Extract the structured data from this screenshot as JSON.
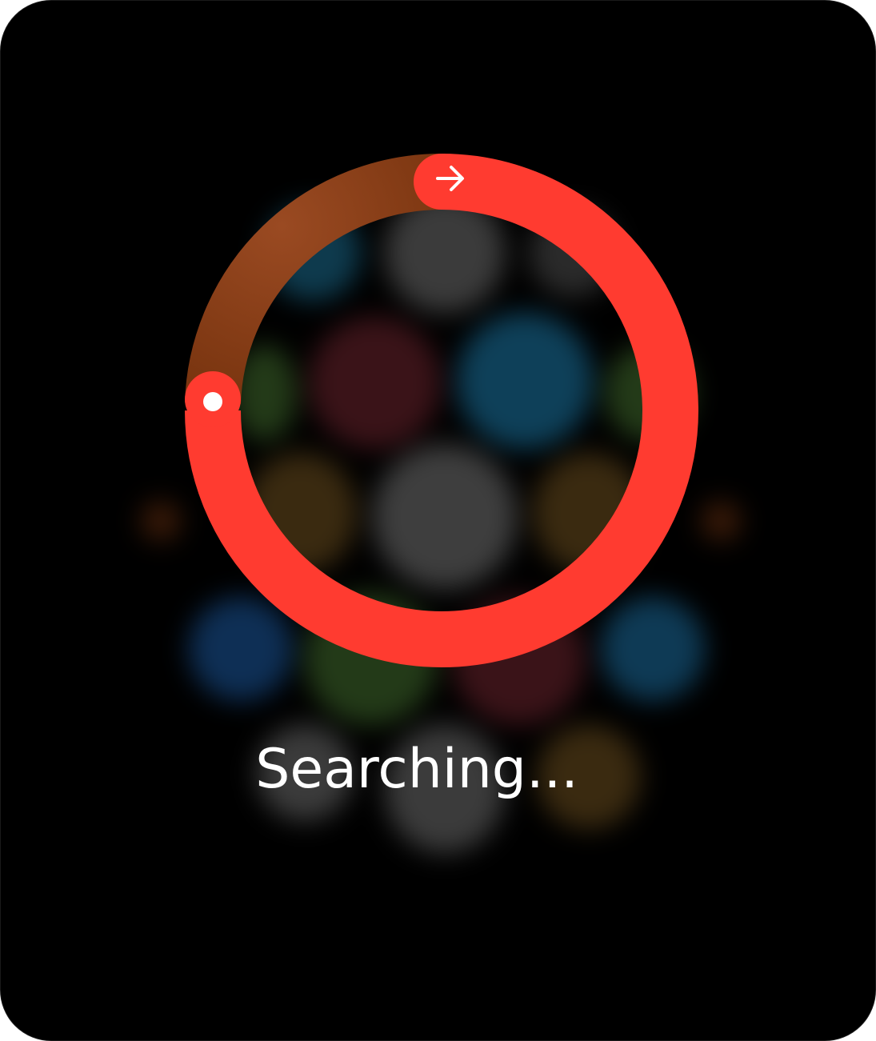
{
  "status": {
    "text": "Searching..."
  },
  "activity_ring": {
    "progress": 0.75,
    "color": "#ff3b30",
    "track_color": "#8b3a12",
    "start_icon": "arrow-right-icon",
    "end_icon": "dot-icon"
  },
  "background_apps": {
    "colors": [
      "#0e3a4d",
      "#3b3b3b",
      "#2a2a2a",
      "#3a1318",
      "#0e4059",
      "#233a18",
      "#3a2a10",
      "#3e3e3e",
      "#3a2a10",
      "#3a1a08",
      "#3a1a08",
      "#0e2f55",
      "#233a18",
      "#3a1318",
      "#0e3a55",
      "#3b3b3b",
      "#3b3b3b",
      "#3a2a10"
    ]
  }
}
